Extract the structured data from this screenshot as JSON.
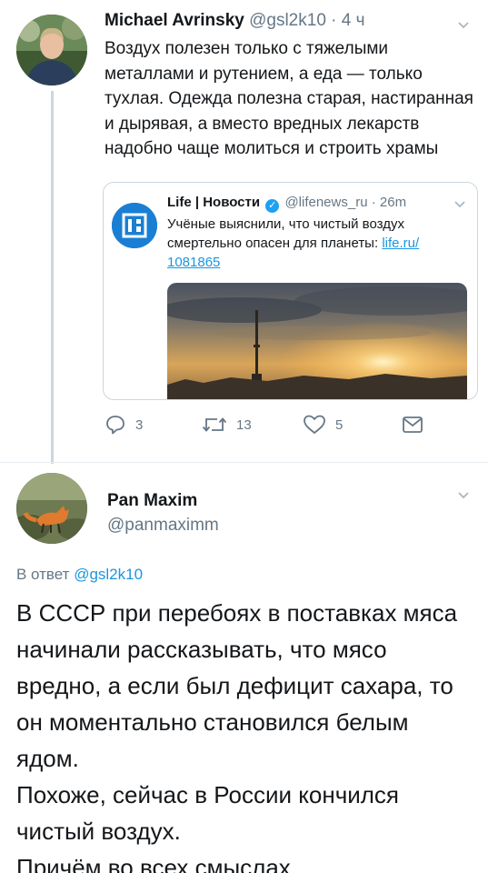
{
  "tweet1": {
    "name": "Michael Avrinsky",
    "handle": "@gsl2k10",
    "separator": "·",
    "time": "4 ч",
    "text": "Воздух полезен только с тяжелыми металлами и рутением, а еда — только тухлая. Одежда полезна старая, настиранная и дырявая, а вместо вредных лекарств надобно чаще молиться и строить храмы",
    "quote": {
      "name": "Life | Новости",
      "verified_glyph": "✓",
      "handle": "@lifenews_ru",
      "separator": "·",
      "time": "26m",
      "text": "Учёные выяснили, что чистый воздух смертельно опасен для планеты: ",
      "link": "life.ru/ 1081865"
    },
    "actions": {
      "replies": "3",
      "retweets": "13",
      "likes": "5"
    }
  },
  "tweet2": {
    "name": "Pan Maxim",
    "handle": "@panmaximm",
    "reply_prefix": "В ответ",
    "reply_mention": "@gsl2k10",
    "text_lines": [
      "В СССР при перебоях в поставках мяса начинали рассказывать, что мясо вредно, а если был дефицит сахара, то он моментально становился белым ядом.",
      "Похоже, сейчас в России кончился чистый воздух.",
      "Причём во всех смыслах."
    ]
  },
  "colors": {
    "accent": "#1b95e0",
    "secondary_text": "#657786",
    "border": "#ccd6dd"
  },
  "icons": [
    "chevron-down-icon",
    "reply-icon",
    "retweet-icon",
    "like-icon",
    "direct-message-icon",
    "verified-icon",
    "life-logo"
  ]
}
